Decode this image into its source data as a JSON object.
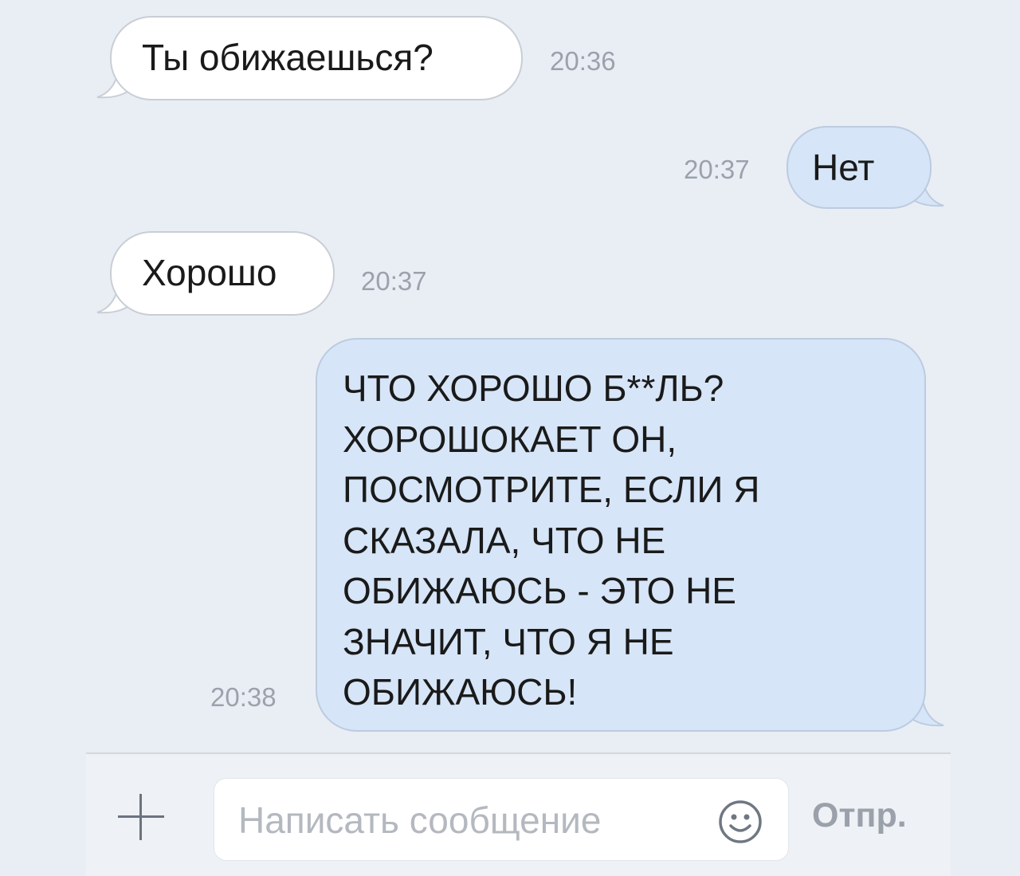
{
  "messages": [
    {
      "direction": "incoming",
      "text": "Ты обижаешься?",
      "time": "20:36"
    },
    {
      "direction": "outgoing",
      "text": "Нет",
      "time": "20:37"
    },
    {
      "direction": "incoming",
      "text": "Хорошо",
      "time": "20:37"
    },
    {
      "direction": "outgoing",
      "text": "ЧТО ХОРОШО Б**ЛЬ?\nХОРОШОКАЕТ ОН,\nПОСМОТРИТЕ, ЕСЛИ Я\nСКАЗАЛА, ЧТО НЕ\nОБИЖАЮСЬ - ЭТО НЕ\nЗНАЧИТ, ЧТО Я НЕ\nОБИЖАЮСЬ!",
      "time": "20:38"
    }
  ],
  "composer": {
    "add_icon": "plus-icon",
    "placeholder": "Написать сообщение",
    "emoji_icon": "smile-icon",
    "send_label": "Отпр."
  },
  "colors": {
    "background": "#e9eef5",
    "incoming_bubble": "#ffffff",
    "outgoing_bubble": "#d6e5f7",
    "bubble_border": "#c9ced6",
    "timestamp": "#9ba2ac",
    "placeholder": "#b4b8bf",
    "send_button": "#9aa1ab"
  }
}
